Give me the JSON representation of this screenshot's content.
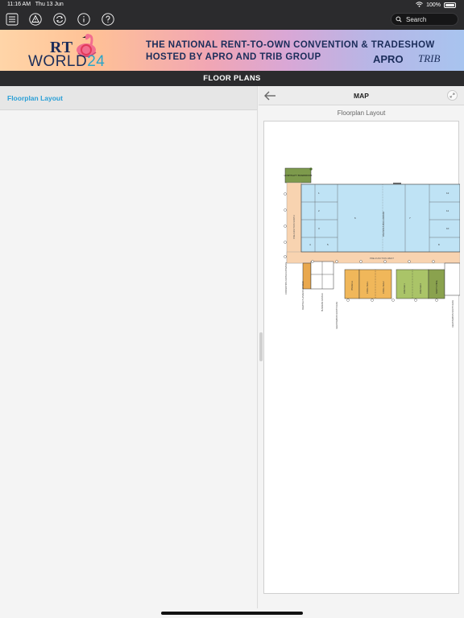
{
  "status": {
    "time": "11:16 AM",
    "date": "Thu 13 Jun",
    "battery": "100%"
  },
  "toolbar": {
    "buttons": [
      {
        "icon": "menu-icon"
      },
      {
        "icon": "alert-icon"
      },
      {
        "icon": "sync-icon"
      },
      {
        "icon": "info-icon"
      },
      {
        "icon": "help-icon"
      }
    ],
    "search_placeholder": "Search"
  },
  "banner": {
    "logo_top": "RT",
    "logo_bottom_a": "WORLD",
    "logo_bottom_b": "24",
    "line1": "THE NATIONAL RENT-TO-OWN CONVENTION & TRADESHOW",
    "line2": "HOSTED BY APRO AND TRIB GROUP",
    "sponsor1": "APRO",
    "sponsor2": "TRIB"
  },
  "section": {
    "title": "FLOOR PLANS"
  },
  "left": {
    "items": [
      {
        "label": "Floorplan Layout"
      }
    ]
  },
  "map": {
    "title": "MAP",
    "subtitle": "Floorplan Layout",
    "labels": {
      "hospitality": "HOSPITALITY BOARDROOM",
      "prefunction_north": "PRE-FUNCTION NORTH",
      "pacifica": "PACIFICA BALLROOM",
      "prefunction_west": "PRE-FUNCTION WEST",
      "convention_entrance": "CONVENTION CENTER ENTRANCE",
      "meeting_planners": "MEETING PLANNERS OFFICES",
      "business_center": "BUSINESS CENTER",
      "registration_north": "REGISTRATION NORTH DESK",
      "registration_south": "REGISTRATION SOUTH DESK",
      "pinnacle": "PINNACLE",
      "coral_sea_1": "CORAL SEA 1",
      "coral_sea_2": "CORAL SEA 2",
      "java_sea_1": "JAVA SEA 1",
      "java_sea_2": "JAVA SEA 2",
      "south_china": "SOUTH CHINA",
      "room_1": "1",
      "room_2": "2",
      "room_3": "3",
      "room_4": "4",
      "room_5": "5",
      "room_6": "6",
      "room_7": "7",
      "room_8": "8",
      "room_9": "9",
      "room_10": "10",
      "room_11": "11",
      "room_12": "12"
    },
    "colors": {
      "ballroom": "#bfe3f5",
      "prefunction": "#f8d3b0",
      "hospitality": "#7d9a4c",
      "coral": "#f0b75a",
      "java": "#aac468",
      "pinnacle": "#e9a84e"
    }
  }
}
